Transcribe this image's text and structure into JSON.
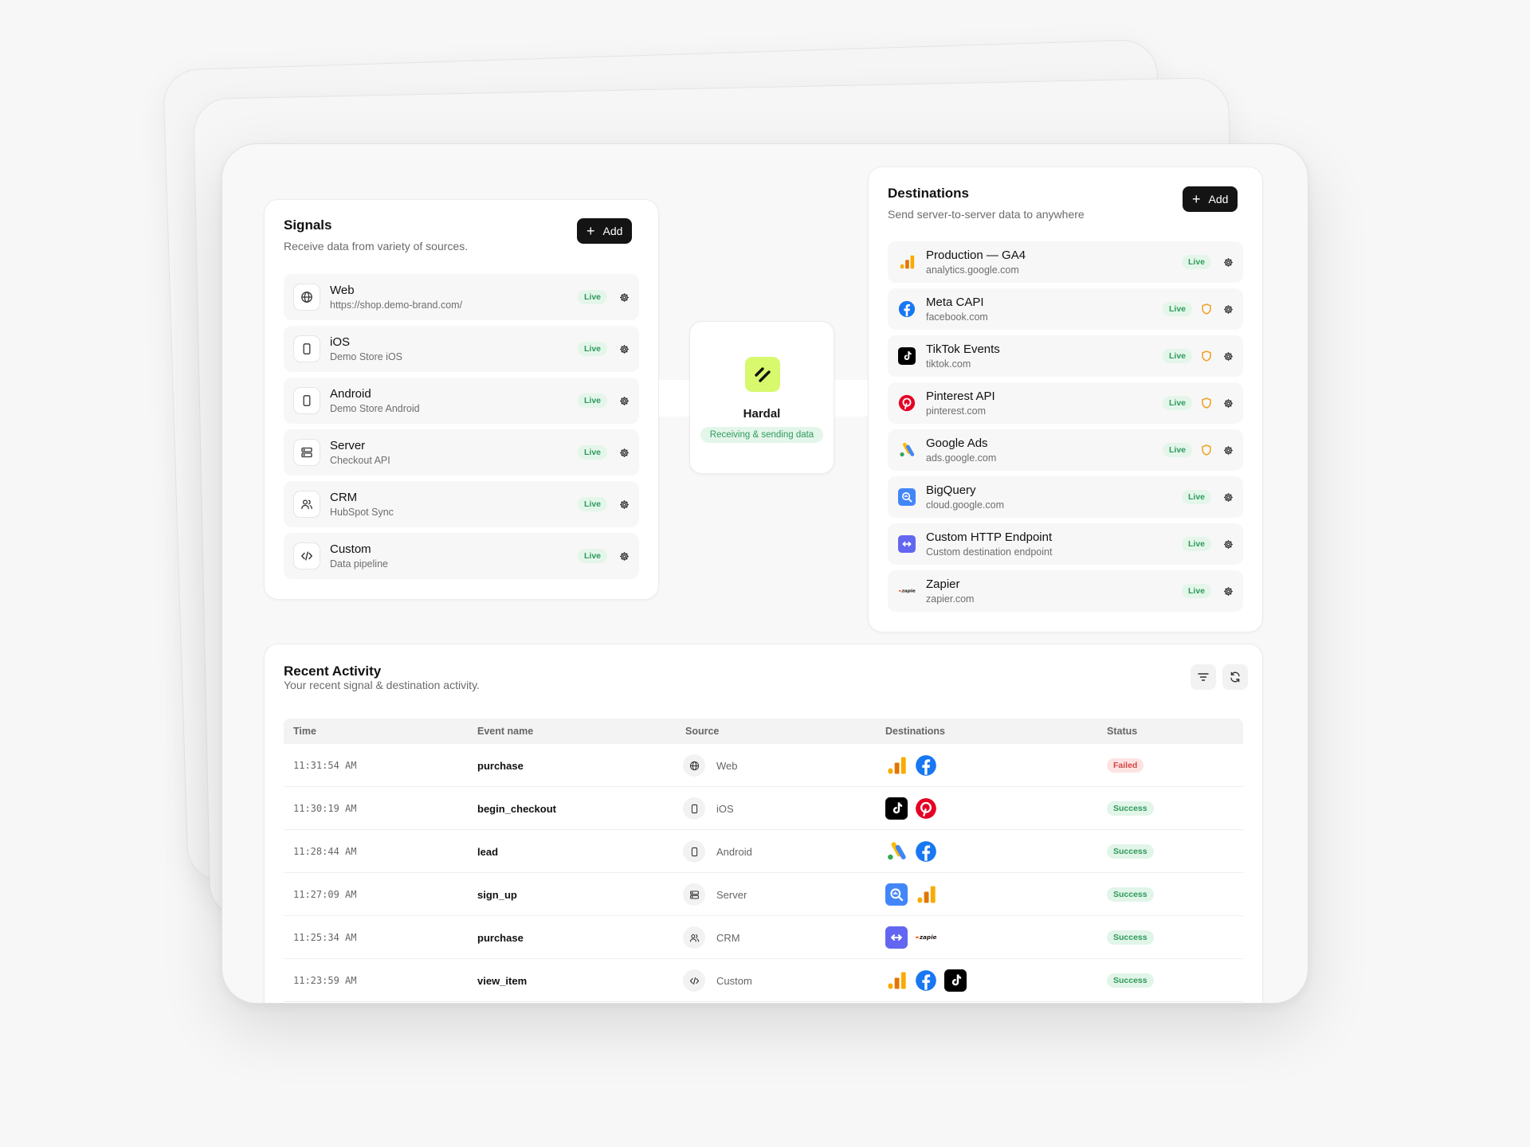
{
  "signals": {
    "title": "Signals",
    "subtitle": "Receive data from variety of sources.",
    "add_label": "Add",
    "items": [
      {
        "name": "Web",
        "desc": "https://shop.demo-brand.com/",
        "status": "Live",
        "icon": "globe-icon"
      },
      {
        "name": "iOS",
        "desc": "Demo Store iOS",
        "status": "Live",
        "icon": "phone-icon"
      },
      {
        "name": "Android",
        "desc": "Demo Store Android",
        "status": "Live",
        "icon": "phone-icon"
      },
      {
        "name": "Server",
        "desc": "Checkout API",
        "status": "Live",
        "icon": "server-icon"
      },
      {
        "name": "CRM",
        "desc": "HubSpot Sync",
        "status": "Live",
        "icon": "users-icon"
      },
      {
        "name": "Custom",
        "desc": "Data pipeline",
        "status": "Live",
        "icon": "code-icon"
      }
    ]
  },
  "hub": {
    "name": "Hardal",
    "status": "Receiving & sending data",
    "logo_color": "#d8f86d"
  },
  "destinations": {
    "title": "Destinations",
    "subtitle": "Send server-to-server data to anywhere",
    "add_label": "Add",
    "items": [
      {
        "name": "Production — GA4",
        "desc": "analytics.google.com",
        "status": "Live",
        "shield": false,
        "logo": "ga4-icon"
      },
      {
        "name": "Meta CAPI",
        "desc": "facebook.com",
        "status": "Live",
        "shield": true,
        "logo": "facebook-icon"
      },
      {
        "name": "TikTok Events",
        "desc": "tiktok.com",
        "status": "Live",
        "shield": true,
        "logo": "tiktok-icon"
      },
      {
        "name": "Pinterest API",
        "desc": "pinterest.com",
        "status": "Live",
        "shield": true,
        "logo": "pinterest-icon"
      },
      {
        "name": "Google Ads",
        "desc": "ads.google.com",
        "status": "Live",
        "shield": true,
        "logo": "google-ads-icon"
      },
      {
        "name": "BigQuery",
        "desc": "cloud.google.com",
        "status": "Live",
        "shield": false,
        "logo": "bigquery-icon"
      },
      {
        "name": "Custom HTTP Endpoint",
        "desc": "Custom destination endpoint",
        "status": "Live",
        "shield": false,
        "logo": "http-endpoint-icon"
      },
      {
        "name": "Zapier",
        "desc": "zapier.com",
        "status": "Live",
        "shield": false,
        "logo": "zapier-icon"
      }
    ]
  },
  "activity": {
    "title": "Recent Activity",
    "subtitle": "Your recent signal & destination activity.",
    "columns": [
      "Time",
      "Event name",
      "Source",
      "Destinations",
      "Status"
    ],
    "rows": [
      {
        "time": "11:31:54 AM",
        "event": "purchase",
        "source": "Web",
        "source_icon": "globe-icon",
        "destinations": [
          "ga4-icon",
          "facebook-icon"
        ],
        "status": "Failed"
      },
      {
        "time": "11:30:19 AM",
        "event": "begin_checkout",
        "source": "iOS",
        "source_icon": "phone-icon",
        "destinations": [
          "tiktok-icon",
          "pinterest-icon"
        ],
        "status": "Success"
      },
      {
        "time": "11:28:44 AM",
        "event": "lead",
        "source": "Android",
        "source_icon": "phone-icon",
        "destinations": [
          "google-ads-icon",
          "facebook-icon"
        ],
        "status": "Success"
      },
      {
        "time": "11:27:09 AM",
        "event": "sign_up",
        "source": "Server",
        "source_icon": "server-icon",
        "destinations": [
          "bigquery-icon",
          "ga4-icon"
        ],
        "status": "Success"
      },
      {
        "time": "11:25:34 AM",
        "event": "purchase",
        "source": "CRM",
        "source_icon": "users-icon",
        "destinations": [
          "http-endpoint-icon",
          "zapier-icon"
        ],
        "status": "Success"
      },
      {
        "time": "11:23:59 AM",
        "event": "view_item",
        "source": "Custom",
        "source_icon": "code-icon",
        "destinations": [
          "ga4-icon",
          "facebook-icon",
          "tiktok-icon"
        ],
        "status": "Success"
      }
    ]
  },
  "colors": {
    "live_green": "#2e9a5c",
    "failed_red": "#d64545",
    "shield_amber": "#f0a020",
    "button_dark": "#141414"
  }
}
